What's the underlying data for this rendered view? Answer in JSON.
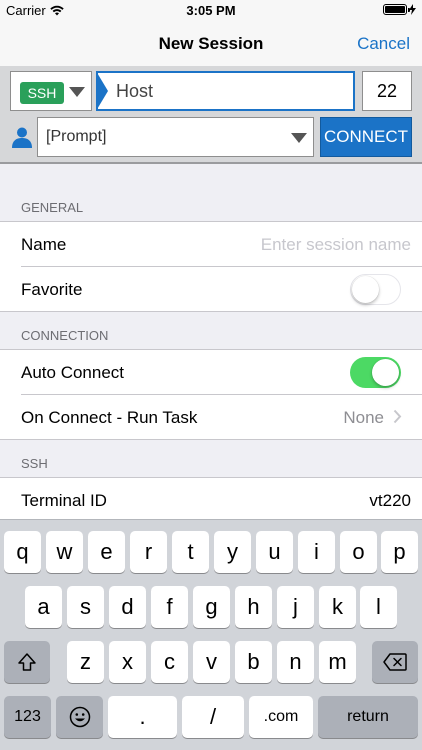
{
  "status_bar": {
    "carrier": "Carrier",
    "time": "3:05 PM",
    "wifi_icon": "wifi-icon",
    "battery_icon": "battery-icon",
    "charging_icon": "lightning-icon"
  },
  "nav": {
    "title": "New Session",
    "cancel_label": "Cancel"
  },
  "connection": {
    "protocol": "SSH",
    "host_value": "Host",
    "port_value": "22",
    "user_value": "[Prompt]",
    "connect_label": "CONNECT"
  },
  "sections": {
    "general": {
      "header": "GENERAL",
      "name_label": "Name",
      "name_placeholder": "Enter session name",
      "favorite_label": "Favorite",
      "favorite_on": false
    },
    "connection": {
      "header": "CONNECTION",
      "auto_connect_label": "Auto Connect",
      "auto_connect_on": true,
      "run_task_label": "On Connect - Run Task",
      "run_task_value": "None"
    },
    "ssh": {
      "header": "SSH",
      "terminal_id_label": "Terminal ID",
      "terminal_id_value": "vt220"
    }
  },
  "keyboard": {
    "row1": [
      "q",
      "w",
      "e",
      "r",
      "t",
      "y",
      "u",
      "i",
      "o",
      "p"
    ],
    "row2": [
      "a",
      "s",
      "d",
      "f",
      "g",
      "h",
      "j",
      "k",
      "l"
    ],
    "row3": [
      "z",
      "x",
      "c",
      "v",
      "b",
      "n",
      "m"
    ],
    "numbers_key": "123",
    "dot_key": ".",
    "slash_key": "/",
    "dotcom_key": ".com",
    "return_key": "return"
  },
  "colors": {
    "accent": "#1b73c7",
    "protocol_badge": "#2aa05a",
    "toggle_on": "#4cd964"
  }
}
